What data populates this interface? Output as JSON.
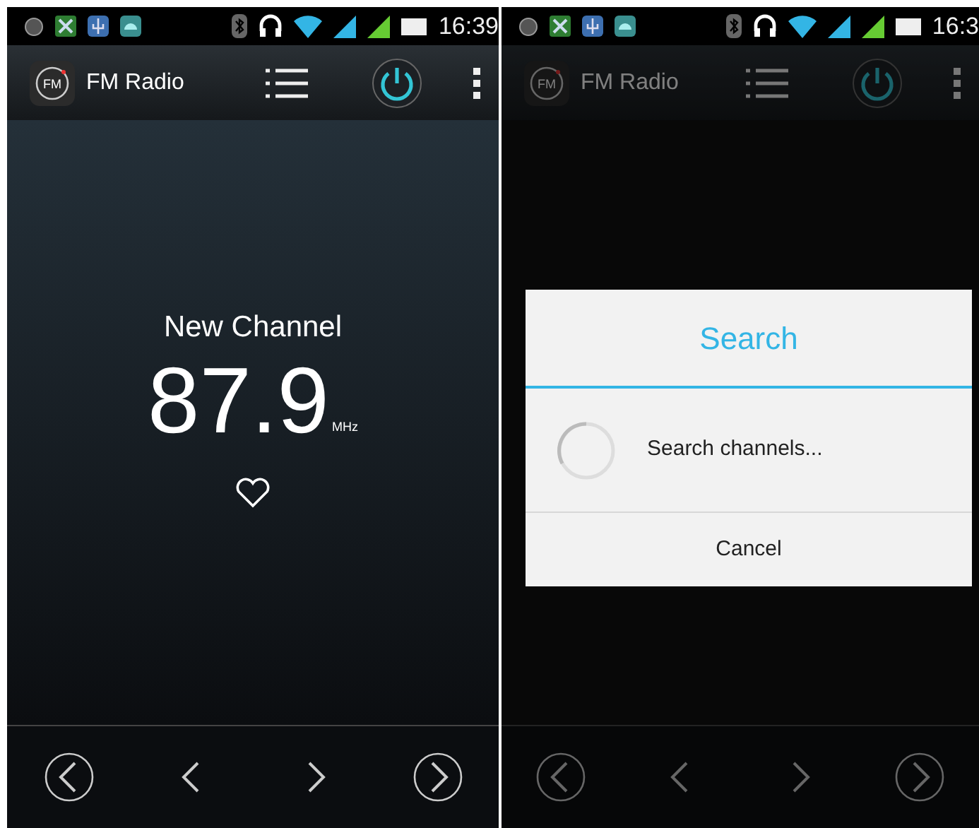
{
  "screens": [
    {
      "status_bar": {
        "time": "16:39"
      },
      "app_bar": {
        "logo": "FM",
        "title": "FM Radio"
      },
      "dimmed": false,
      "station": {
        "name": "New Channel",
        "frequency": "87.9",
        "unit": "MHz"
      }
    },
    {
      "status_bar": {
        "time": "16:3"
      },
      "app_bar": {
        "logo": "FM",
        "title": "FM Radio"
      },
      "dimmed": true,
      "dialog": {
        "title": "Search",
        "message": "Search channels...",
        "button": "Cancel"
      }
    }
  ]
}
